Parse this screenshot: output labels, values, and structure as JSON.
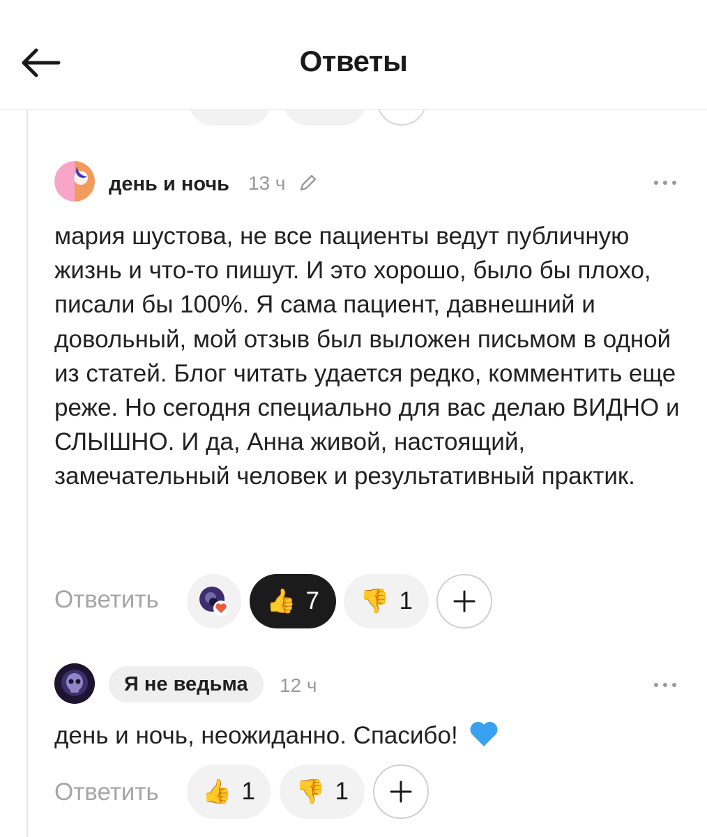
{
  "header": {
    "title": "Ответы"
  },
  "comments": [
    {
      "author": "день и ночь",
      "time": "13 ч",
      "text": "мария шустова, не все пациенты ведут публичную жизнь и что-то пишут. И это хорошо, было бы плохо, писали бы 100%. Я сама пациент, давнешний и довольный, мой отзыв был выложен письмом в одной из статей. Блог читать удается редко, комментить еще реже. Но сегодня специально для вас делаю ВИДНО и СЛЫШНО. И да, Анна живой, настоящий, замечательный человек и результативный практик.",
      "reply_label": "Ответить",
      "likes": "7",
      "dislikes": "1",
      "liked_by_author": true
    },
    {
      "author": "Я не ведьма",
      "time": "12 ч",
      "text": "день и ночь, неожиданно. Спасибо!",
      "reply_label": "Ответить",
      "likes": "1",
      "dislikes": "1"
    }
  ],
  "icons": {
    "back": "arrow-left-icon",
    "edit": "pencil-icon",
    "more": "more-dots-icon",
    "like": "thumbs-up-icon",
    "dislike": "thumbs-down-icon",
    "add": "plus-icon",
    "heart": "blue-heart-icon"
  },
  "colors": {
    "active_like_bg": "#1b1b1b",
    "pill_bg": "#f2f2f2",
    "muted_text": "#9a9a9a",
    "heart": "#3aa0f0",
    "heart_badge": "#f05a3c"
  }
}
